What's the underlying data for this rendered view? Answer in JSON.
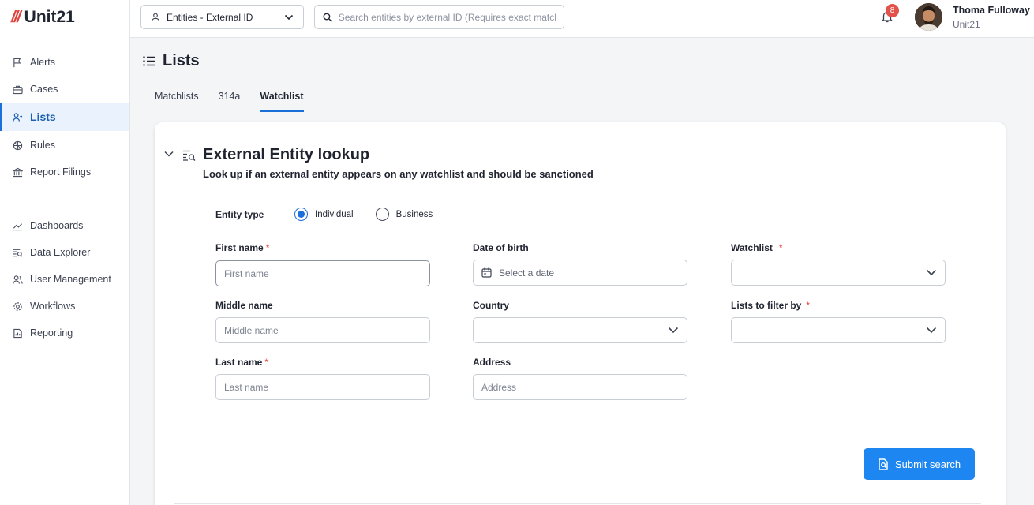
{
  "brand": {
    "mark": "///",
    "name": "Unit21",
    "accent": "#e0413a"
  },
  "sidebar": {
    "items": [
      {
        "label": "Alerts",
        "icon": "flag-icon",
        "active": false
      },
      {
        "label": "Cases",
        "icon": "briefcase-icon",
        "active": false
      },
      {
        "label": "Lists",
        "icon": "user-list-icon",
        "active": true
      },
      {
        "label": "Rules",
        "icon": "rules-icon",
        "active": false
      },
      {
        "label": "Report Filings",
        "icon": "bank-icon",
        "active": false
      },
      {
        "label": "Dashboards",
        "icon": "chart-line-icon",
        "active": false
      },
      {
        "label": "Data Explorer",
        "icon": "data-search-icon",
        "active": false
      },
      {
        "label": "User Management",
        "icon": "users-icon",
        "active": false
      },
      {
        "label": "Workflows",
        "icon": "gear-icon",
        "active": false
      },
      {
        "label": "Reporting",
        "icon": "report-icon",
        "active": false
      }
    ]
  },
  "topbar": {
    "entity_select": "Entities - External ID",
    "search_placeholder": "Search entities by external ID (Requires exact match)",
    "notifications_count": "8",
    "user_name": "Thoma Fulloway",
    "user_org": "Unit21"
  },
  "page": {
    "title": "Lists",
    "tabs": [
      {
        "label": "Matchlists",
        "active": false
      },
      {
        "label": "314a",
        "active": false
      },
      {
        "label": "Watchlist",
        "active": true
      }
    ]
  },
  "lookup": {
    "title": "External Entity lookup",
    "subtitle": "Look up if an external entity appears on any watchlist and should be sanctioned",
    "entity_type_label": "Entity type",
    "entity_types": [
      {
        "label": "Individual",
        "selected": true
      },
      {
        "label": "Business",
        "selected": false
      }
    ],
    "first_name_label": "First name",
    "first_name_placeholder": "First name",
    "middle_name_label": "Middle name",
    "middle_name_placeholder": "Middle name",
    "last_name_label": "Last name",
    "last_name_placeholder": "Last name",
    "dob_label": "Date of birth",
    "dob_placeholder": "Select a date",
    "country_label": "Country",
    "country_value": "",
    "address_label": "Address",
    "address_placeholder": "Address",
    "watchlist_label": "Watchlist",
    "watchlist_value": "",
    "lists_filter_label": "Lists to filter by",
    "lists_filter_value": "",
    "required_mark": "*",
    "submit_label": "Submit search"
  },
  "colors": {
    "primary": "#1e86f0",
    "active_nav": "#1b5fb4",
    "badge": "#e2524b"
  }
}
